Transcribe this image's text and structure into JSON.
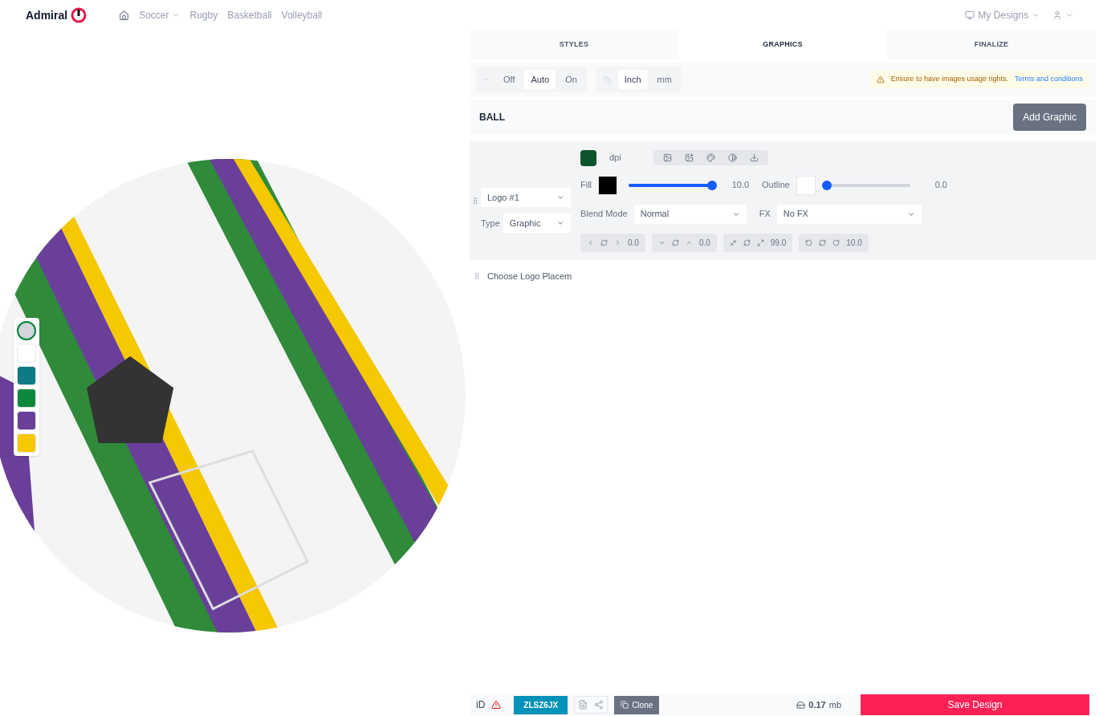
{
  "nav": {
    "brand": "Admiral",
    "links": [
      {
        "label": "Soccer",
        "dropdown": true
      },
      {
        "label": "Rugby",
        "dropdown": false
      },
      {
        "label": "Basketball",
        "dropdown": false
      },
      {
        "label": "Volleyball",
        "dropdown": false
      }
    ],
    "my_designs": "My Designs"
  },
  "swatches": [
    {
      "kind": "thumb"
    },
    {
      "kind": "color",
      "color": "#ffffff"
    },
    {
      "kind": "color",
      "color": "#0e7a84"
    },
    {
      "kind": "color",
      "color": "#0b8a3e"
    },
    {
      "kind": "color",
      "color": "#6a3f9a"
    },
    {
      "kind": "color",
      "color": "#f5c800"
    }
  ],
  "tabs": [
    {
      "label": "STYLES",
      "selected": false
    },
    {
      "label": "GRAPHICS",
      "selected": true
    },
    {
      "label": "FINALIZE",
      "selected": false
    }
  ],
  "toolbar": {
    "mode": [
      {
        "label": "Off",
        "selected": false
      },
      {
        "label": "Auto",
        "selected": true
      },
      {
        "label": "On",
        "selected": false
      }
    ],
    "units": [
      {
        "label": "Inch",
        "selected": true
      },
      {
        "label": "mm",
        "selected": false
      }
    ],
    "notice": "Ensure to have images usage rights.",
    "notice_link": "Terms and conditions"
  },
  "section": {
    "title": "BALL",
    "add_button": "Add Graphic"
  },
  "graphic": {
    "dpi_label": "dpi",
    "logo_select": "Logo #1",
    "type_label": "Type",
    "type_select": "Graphic",
    "fill": {
      "label": "Fill",
      "color": "#000000",
      "level": 1.0,
      "reading": "10.0"
    },
    "outline": {
      "label": "Outline",
      "color": "#ffffff",
      "level": 0.0,
      "reading": "0.0"
    },
    "blend_label": "Blend Mode",
    "blend_select": "Normal",
    "fx_label": "FX",
    "fx_select": "No FX",
    "transforms": [
      {
        "kind": "horizontal",
        "value": "0.0"
      },
      {
        "kind": "vertical",
        "value": "0.0"
      },
      {
        "kind": "scale",
        "value": "99.0"
      },
      {
        "kind": "rotate",
        "value": "10.0"
      }
    ]
  },
  "placement": "Choose Logo Placem",
  "footer": {
    "id_label": "iD",
    "id_code": "ZLSZ6JX",
    "clone": "Clone",
    "size_value": "0.17",
    "size_unit": "mb",
    "save": "Save Design"
  }
}
